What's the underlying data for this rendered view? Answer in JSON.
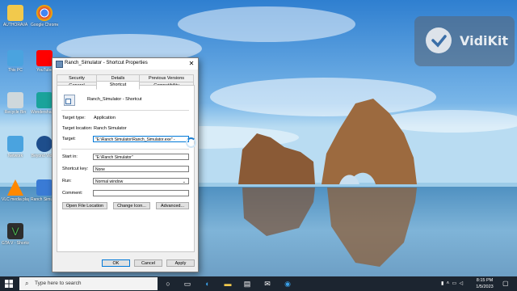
{
  "desktop": {
    "icons": [
      {
        "label": "AUTHORAVA",
        "color": "#f2c94c"
      },
      {
        "label": "Google Chrome",
        "color": "#db4437"
      },
      {
        "label": "This PC",
        "color": "#4aa3df"
      },
      {
        "label": "YouTube",
        "color": "#ff0000"
      },
      {
        "label": "Recycle Bin",
        "color": "#cfd8dc"
      },
      {
        "label": "Wondershare Filmora",
        "color": "#1aa39b"
      },
      {
        "label": "Network",
        "color": "#4aa3df"
      },
      {
        "label": "Beyond VidiKit",
        "color": "#1e4e8c"
      },
      {
        "label": "VLC media player",
        "color": "#ff8800"
      },
      {
        "label": "Ranch Simulator - Shortcut",
        "color": "#3a7bd5"
      },
      {
        "label": "GTA V - Shortcut",
        "color": "#4caf50"
      }
    ]
  },
  "watermark": {
    "text": "VidiKit"
  },
  "dialog": {
    "title": "Ranch_Simulator - Shortcut Properties",
    "close": "✕",
    "tabs_row1": [
      "Security",
      "Details",
      "Previous Versions"
    ],
    "tabs_row2": [
      "General",
      "Shortcut",
      "Compatibility"
    ],
    "active_tab": "Shortcut",
    "app_name": "Ranch_Simulator - Shortcut",
    "target_type_label": "Target type:",
    "target_type": "Application",
    "target_location_label": "Target location:",
    "target_location": "Ranch Simulator",
    "target_label": "Target:",
    "target_value": "\"E:\\Ranch Simulator\\Ranch_Simulator.exe\" -",
    "start_in_label": "Start in:",
    "start_in_value": "\"E:\\Ranch Simulator\"",
    "shortcut_key_label": "Shortcut key:",
    "shortcut_key_value": "None",
    "run_label": "Run:",
    "run_value": "Normal window",
    "comment_label": "Comment:",
    "comment_value": "",
    "btn_open_location": "Open File Location",
    "btn_change_icon": "Change Icon...",
    "btn_advanced": "Advanced...",
    "btn_ok": "OK",
    "btn_cancel": "Cancel",
    "btn_apply": "Apply"
  },
  "taskbar": {
    "search_placeholder": "Type here to search",
    "time": "8:15 PM",
    "date": "1/5/2023"
  }
}
